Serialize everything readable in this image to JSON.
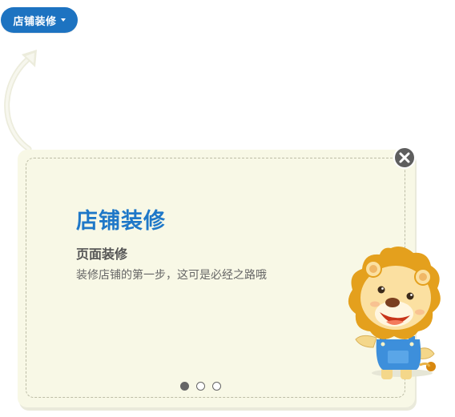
{
  "menu": {
    "label": "店铺装修",
    "caret_icon": "caret-down-icon",
    "color": "#1d73c1"
  },
  "guide": {
    "title": "店铺装修",
    "subtitle": "页面装修",
    "description": "装修店铺的第一步，这可是必经之路哦",
    "title_color": "#1f78c8",
    "background": "#f8f8e6",
    "close_icon": "close-icon",
    "mascot_icon": "lion-mascot-icon",
    "pagination": {
      "total": 3,
      "current": 1
    }
  }
}
